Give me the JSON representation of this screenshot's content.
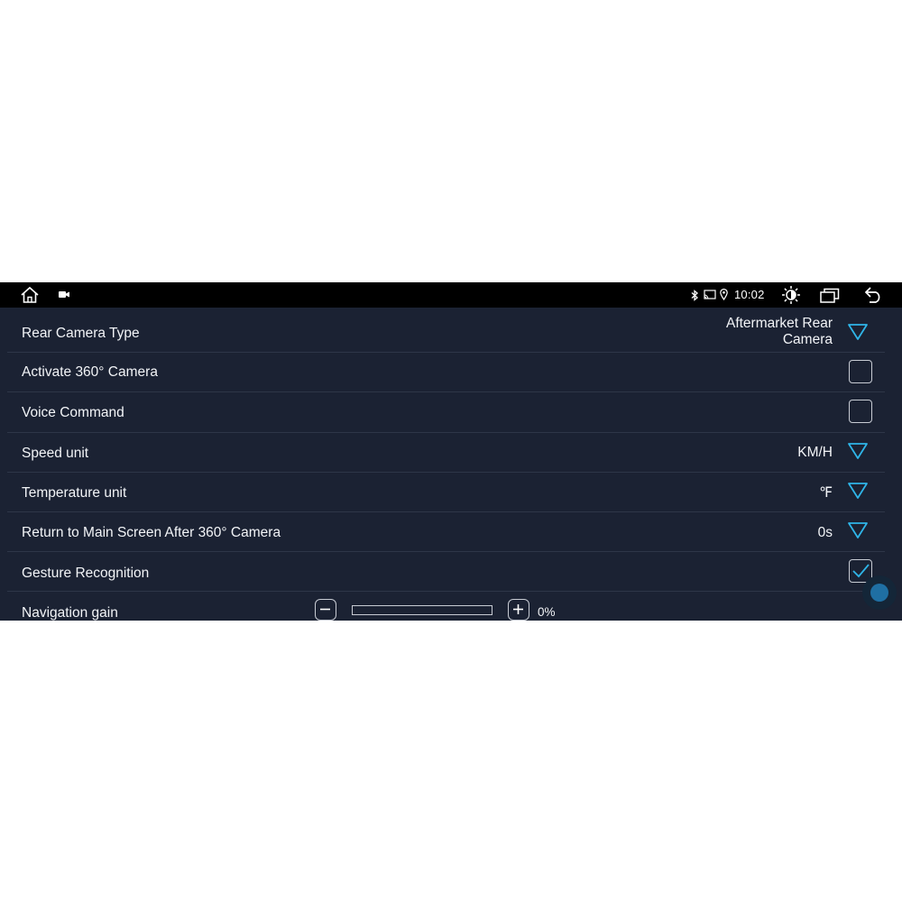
{
  "status_bar": {
    "time": "10:02",
    "icons": [
      "home-icon",
      "camera-icon",
      "bluetooth-icon",
      "cast-icon",
      "location-icon",
      "brightness-icon",
      "recent-apps-icon",
      "back-icon"
    ]
  },
  "settings": {
    "rear_camera_type": {
      "label": "Rear Camera Type",
      "value": "Aftermarket Rear Camera"
    },
    "activate_360": {
      "label": "Activate 360° Camera",
      "checked": false
    },
    "voice_command": {
      "label": "Voice Command",
      "checked": false
    },
    "speed_unit": {
      "label": "Speed unit",
      "value": "KM/H"
    },
    "temperature_unit": {
      "label": "Temperature unit",
      "value": "℉"
    },
    "return_main": {
      "label": "Return to Main Screen After 360° Camera",
      "value": "0s"
    },
    "gesture_recognition": {
      "label": "Gesture Recognition",
      "checked": true
    },
    "navigation_gain": {
      "label": "Navigation gain",
      "value_text": "0%",
      "value": 0
    }
  },
  "colors": {
    "background": "#1b2233",
    "status_bar": "#000000",
    "accent": "#2fb5e8",
    "text": "#f2f4f7",
    "divider": "#2e3648"
  }
}
